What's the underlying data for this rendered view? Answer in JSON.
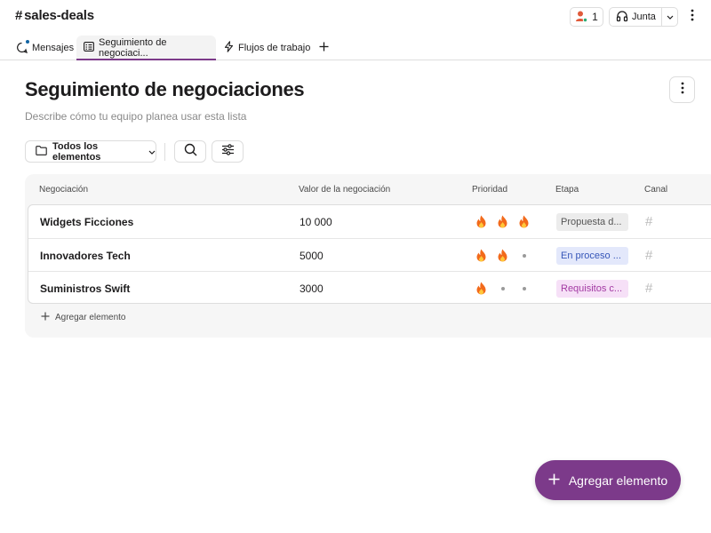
{
  "header": {
    "channel_name": "sales-deals",
    "member_count": "1",
    "huddle_label": "Junta"
  },
  "tabs": [
    {
      "label": "Mensajes",
      "icon": "message-icon",
      "unread": true
    },
    {
      "label": "Seguimiento de negociaci...",
      "icon": "list-icon",
      "active": true
    },
    {
      "label": "Flujos de trabajo",
      "icon": "lightning-icon"
    }
  ],
  "list": {
    "title": "Seguimiento de negociaciones",
    "description": "Describe cómo tu equipo planea usar esta lista"
  },
  "toolbar": {
    "view_label": "Todos los elementos"
  },
  "table": {
    "columns": [
      "Negociación",
      "Valor de la negociación",
      "Prioridad",
      "Etapa",
      "Canal"
    ],
    "rows": [
      {
        "name": "Widgets Ficciones",
        "value": "10 000",
        "priority": 3,
        "stage": "Propuesta d...",
        "stage_bg": "#ececec",
        "stage_fg": "#555555"
      },
      {
        "name": "Innovadores Tech",
        "value": "5000",
        "priority": 2,
        "stage": "En proceso ...",
        "stage_bg": "#e3e8fb",
        "stage_fg": "#3656b8"
      },
      {
        "name": "Suministros Swift",
        "value": "3000",
        "priority": 1,
        "stage": "Requisitos c...",
        "stage_bg": "#f6e0f7",
        "stage_fg": "#a33aa3"
      }
    ],
    "add_label": "Agregar elemento"
  },
  "fab": {
    "label": "Agregar elemento"
  },
  "colors": {
    "accent": "#7c3a8a",
    "unread": "#1264a3",
    "fire": "#f26a1b"
  }
}
